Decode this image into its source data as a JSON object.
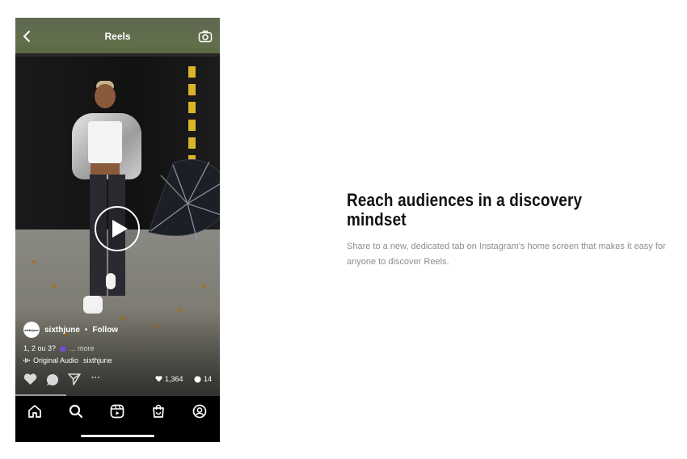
{
  "phone": {
    "title": "Reels",
    "username": "sixthjune",
    "avatar_text": "sixthjune",
    "separator": "•",
    "follow_label": "Follow",
    "caption_text": "1, 2 ou 3?",
    "caption_more": "... more",
    "audio_label": "Original Audio",
    "audio_user": "sixthjune",
    "likes": "1,364",
    "comments": "14",
    "more_label": "···",
    "progress": 0.25,
    "icons": {
      "back": "back-arrow-icon",
      "camera": "camera-icon",
      "play": "play-icon",
      "like": "heart-icon",
      "comment": "comment-icon",
      "share": "send-icon",
      "home": "home-icon",
      "search": "search-icon",
      "reels": "reels-icon",
      "shop": "shop-icon",
      "profile": "profile-icon"
    }
  },
  "feature": {
    "headline": "Reach audiences in a discovery mindset",
    "description": "Share to a new, dedicated tab on Instagram's home screen that makes it easy for anyone to discover Reels."
  },
  "colors": {
    "headline": "#111111",
    "description": "#8d8d8d",
    "phone_bg": "#000000"
  }
}
